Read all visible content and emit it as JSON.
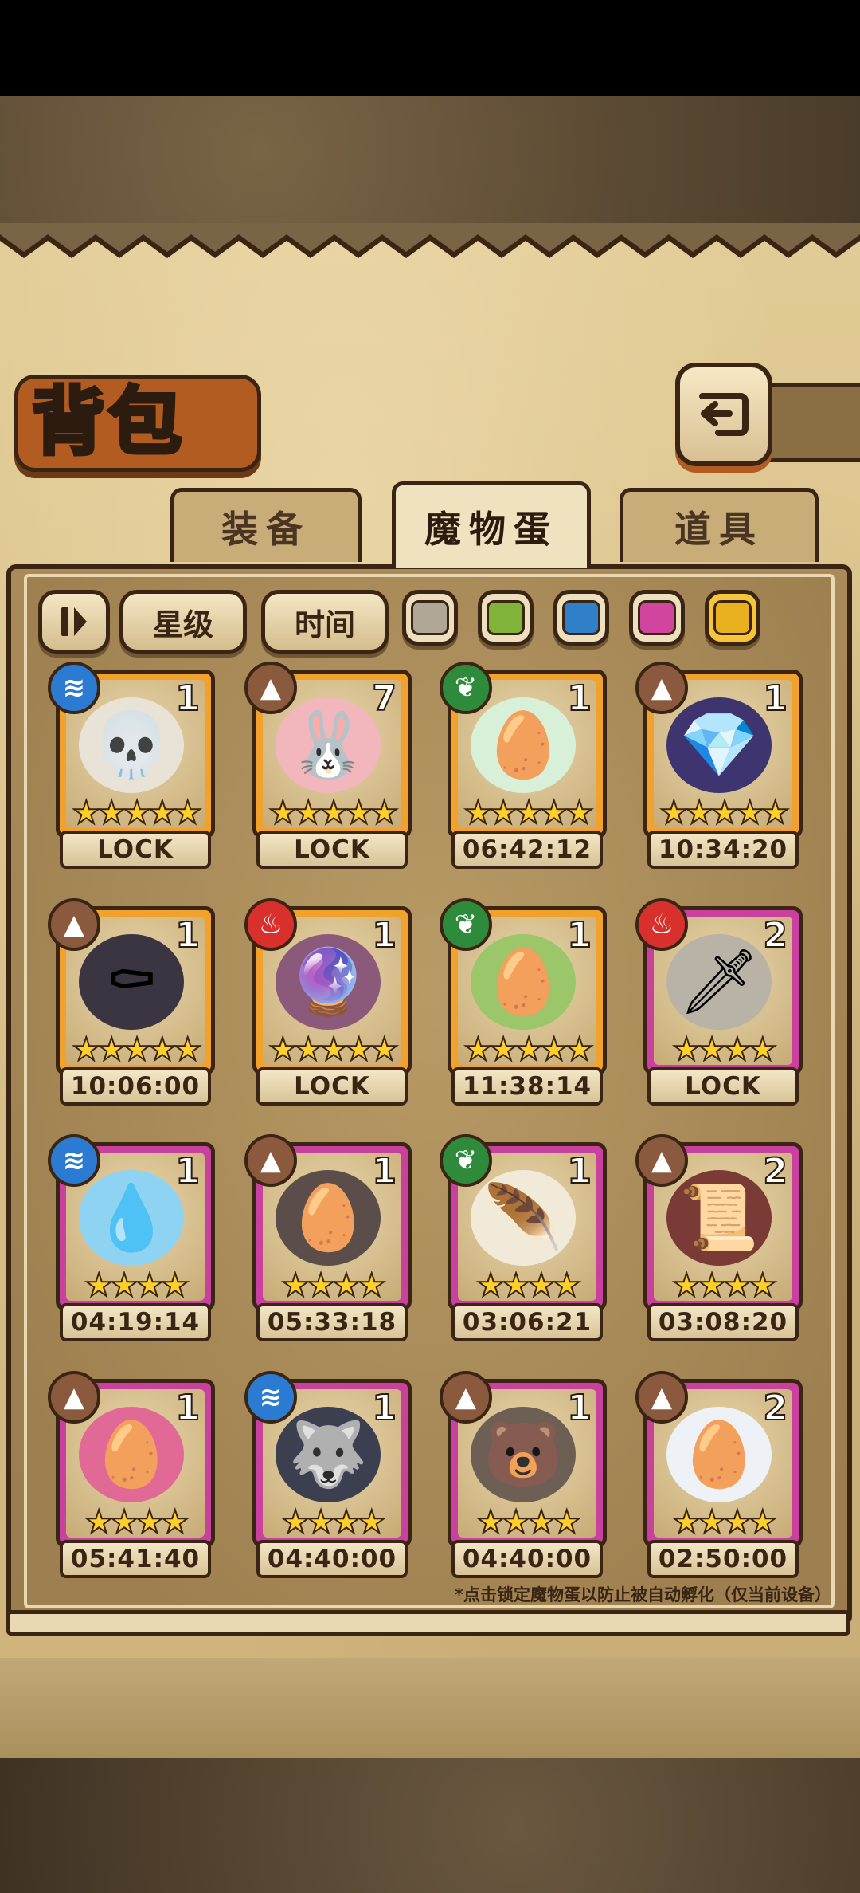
{
  "header": {
    "title": "背包"
  },
  "tabs": [
    {
      "label": "装备",
      "active": false
    },
    {
      "label": "魔物蛋",
      "active": true
    },
    {
      "label": "道具",
      "active": false
    }
  ],
  "filters": {
    "sort_icon": "pause-sort-icon",
    "star_label": "星级",
    "time_label": "时间",
    "color_filters": [
      {
        "name": "gray",
        "color": "#b0a796",
        "selected": false
      },
      {
        "name": "green",
        "color": "#7fb33a",
        "selected": false
      },
      {
        "name": "blue",
        "color": "#2f7fc9",
        "selected": false
      },
      {
        "name": "pink",
        "color": "#d2459e",
        "selected": false
      },
      {
        "name": "gold",
        "color": "#e9b11f",
        "selected": true
      }
    ]
  },
  "eggs": [
    {
      "element": "water",
      "count": "1",
      "stars": "★★★★★",
      "label": "LOCK",
      "rarity": "gold",
      "art": "skull"
    },
    {
      "element": "earth",
      "count": "7",
      "stars": "★★★★★",
      "label": "LOCK",
      "rarity": "gold",
      "art": "bunny"
    },
    {
      "element": "grass",
      "count": "1",
      "stars": "★★★★★",
      "label": "06:42:12",
      "rarity": "gold",
      "art": "leaf-egg"
    },
    {
      "element": "earth",
      "count": "1",
      "stars": "★★★★★",
      "label": "10:34:20",
      "rarity": "gold",
      "art": "crystal"
    },
    {
      "element": "earth",
      "count": "1",
      "stars": "★★★★★",
      "label": "10:06:00",
      "rarity": "gold",
      "art": "coffin"
    },
    {
      "element": "fire",
      "count": "1",
      "stars": "★★★★★",
      "label": "LOCK",
      "rarity": "gold",
      "art": "orb"
    },
    {
      "element": "grass",
      "count": "1",
      "stars": "★★★★★",
      "label": "11:38:14",
      "rarity": "gold",
      "art": "green-egg"
    },
    {
      "element": "fire",
      "count": "2",
      "stars": "★★★★",
      "label": "LOCK",
      "rarity": "purple",
      "art": "dagger"
    },
    {
      "element": "water",
      "count": "1",
      "stars": "★★★★",
      "label": "04:19:14",
      "rarity": "purple",
      "art": "water-egg"
    },
    {
      "element": "earth",
      "count": "1",
      "stars": "★★★★",
      "label": "05:33:18",
      "rarity": "purple",
      "art": "dark-egg"
    },
    {
      "element": "grass",
      "count": "1",
      "stars": "★★★★",
      "label": "03:06:21",
      "rarity": "purple",
      "art": "feather-egg"
    },
    {
      "element": "earth",
      "count": "2",
      "stars": "★★★★",
      "label": "03:08:20",
      "rarity": "purple",
      "art": "scroll"
    },
    {
      "element": "earth",
      "count": "1",
      "stars": "★★★★",
      "label": "05:41:40",
      "rarity": "purple",
      "art": "thorn-egg"
    },
    {
      "element": "water",
      "count": "1",
      "stars": "★★★★",
      "label": "04:40:00",
      "rarity": "purple",
      "art": "anubis"
    },
    {
      "element": "earth",
      "count": "1",
      "stars": "★★★★",
      "label": "04:40:00",
      "rarity": "purple",
      "art": "bear"
    },
    {
      "element": "earth",
      "count": "2",
      "stars": "★★★★",
      "label": "02:50:00",
      "rarity": "purple",
      "art": "wing-egg"
    }
  ],
  "footnote": "*点击锁定魔物蛋以防止被自动孵化（仅当前设备）"
}
